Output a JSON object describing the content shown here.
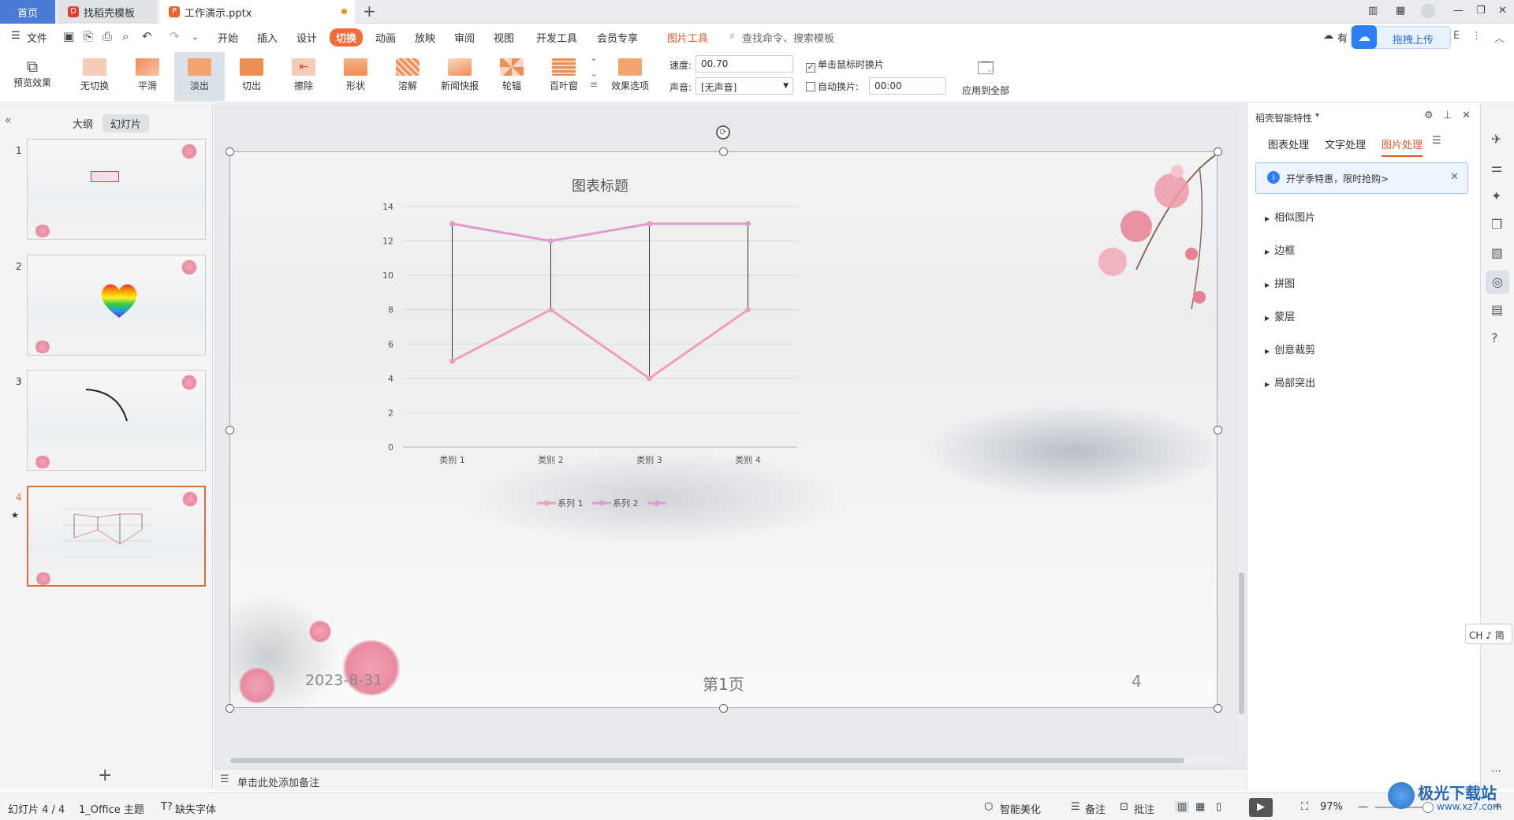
{
  "tabs": {
    "home": "首页",
    "tab2": "找稻壳模板",
    "tab3": "工作演示.pptx"
  },
  "menu": {
    "file": "文件",
    "items": [
      "开始",
      "插入",
      "设计",
      "切换",
      "动画",
      "放映",
      "审阅",
      "视图",
      "开发工具",
      "会员专享"
    ],
    "picture_tools": "图片工具",
    "search_placeholder": "查找命令、搜索模板",
    "cloud_partial": "有",
    "upload": "拖拽上传"
  },
  "ribbon": {
    "preview": "预览效果",
    "transitions": [
      "无切换",
      "平滑",
      "淡出",
      "切出",
      "擦除",
      "形状",
      "溶解",
      "新闻快报",
      "轮辐",
      "百叶窗"
    ],
    "effect_options": "效果选项",
    "speed_label": "速度:",
    "speed_value": "00.70",
    "sound_label": "声音:",
    "sound_value": "[无声音]",
    "on_click": "单击鼠标时换片",
    "auto_advance": "自动换片:",
    "auto_time": "00:00",
    "apply_all": "应用到全部"
  },
  "left_panel": {
    "tab_outline": "大纲",
    "tab_slides": "幻灯片",
    "slide_numbers": [
      "1",
      "2",
      "3",
      "4"
    ],
    "add_icon": "plus-icon"
  },
  "slide": {
    "date": "2023-8-31",
    "footer": "第1页",
    "page_number": "4"
  },
  "chart_data": {
    "type": "line",
    "title": "图表标题",
    "categories": [
      "类别 1",
      "类别 2",
      "类别 3",
      "类别 4"
    ],
    "ylim": [
      0,
      14
    ],
    "yticks": [
      "0",
      "2",
      "4",
      "6",
      "8",
      "10",
      "12",
      "14"
    ],
    "series": [
      {
        "name": "系列 1",
        "values": [
          5,
          8,
          4,
          8
        ],
        "color": "#f0a0ae"
      },
      {
        "name": "系列 2",
        "values": [
          13,
          12,
          13,
          13
        ],
        "color": "#e29bcb"
      },
      {
        "name": "",
        "values": [],
        "color": "#e29bcb"
      }
    ],
    "high_low_lines": true,
    "legend": "bottom"
  },
  "notes": {
    "placeholder": "单击此处添加备注"
  },
  "right_panel": {
    "title": "稻壳智能特性",
    "tabs": [
      "图表处理",
      "文字处理",
      "图片处理"
    ],
    "promo": "开学季特惠，限时抢购>",
    "items": [
      "相似图片",
      "边框",
      "拼图",
      "蒙层",
      "创意裁剪",
      "局部突出"
    ]
  },
  "ime": "CH ♪ 简",
  "status": {
    "slide_count": "幻灯片 4 / 4",
    "theme": "1_Office 主题",
    "missing_font": "缺失字体",
    "beautify": "智能美化",
    "notes": "备注",
    "comments": "批注",
    "zoom": "97%"
  },
  "watermark": "极光下载站",
  "watermark_url": "www.xz7.com",
  "colors": {
    "accent": "#e0592a",
    "home_tab": "#4a7bd6",
    "selection": "#e36f36"
  }
}
